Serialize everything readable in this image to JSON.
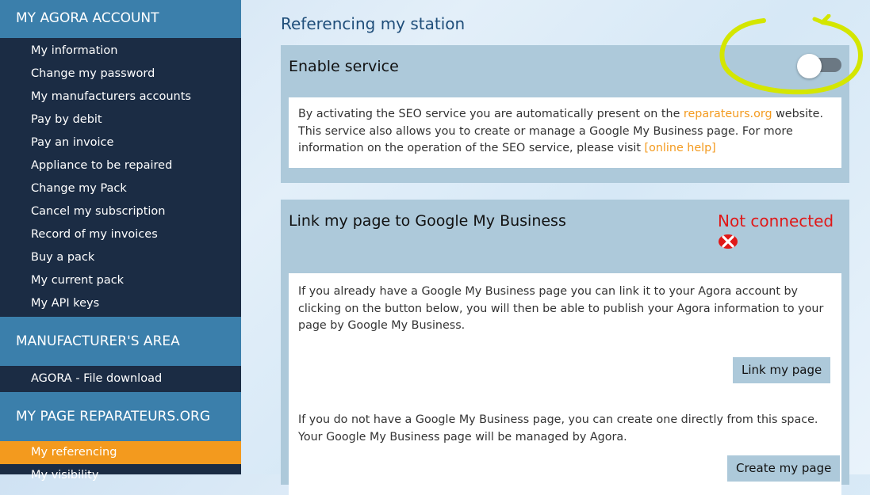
{
  "sidebar": {
    "section1": {
      "title": "MY AGORA ACCOUNT",
      "items": [
        {
          "label": "My information"
        },
        {
          "label": "Change my password"
        },
        {
          "label": "My manufacturers accounts"
        },
        {
          "label": "Pay by debit"
        },
        {
          "label": "Pay an invoice"
        },
        {
          "label": "Appliance to be repaired"
        },
        {
          "label": "Change my Pack"
        },
        {
          "label": "Cancel my subscription"
        },
        {
          "label": "Record of my invoices"
        },
        {
          "label": "Buy a pack"
        },
        {
          "label": "My current pack"
        },
        {
          "label": "My API keys"
        }
      ]
    },
    "section2": {
      "title": "MANUFACTURER'S AREA",
      "items": [
        {
          "label": "AGORA - File download"
        }
      ]
    },
    "section3": {
      "title": "MY PAGE REPARATEURS.ORG",
      "items": [
        {
          "label": "My referencing",
          "active": true
        },
        {
          "label": "My visibility"
        }
      ]
    }
  },
  "main": {
    "title": "Referencing my station",
    "service_panel": {
      "title": "Enable service",
      "toggle_enabled": false,
      "text_before": "By activating the SEO service you are automatically present on the ",
      "site_link": "reparateurs.org",
      "text_after": " website. This service also allows you to create or manage a Google My Business page. For more information on the operation of the SEO service, please visit ",
      "help_link": "[online help]"
    },
    "gmb_panel": {
      "title": "Link my page to Google My Business",
      "status": "Not connected",
      "status_icon": "error-x-icon",
      "link_text": "If you already have a Google My Business page you can link it to your Agora account by clicking on the button below, you will then be able to publish your Agora information to your page by Google My Business.",
      "link_button": "Link my page",
      "create_text": "If you do not have a Google My Business page, you can create one directly from this space. Your Google My Business page will be managed by Agora.",
      "create_button": "Create my page"
    }
  },
  "colors": {
    "sidebar_bg": "#1b2c44",
    "sidebar_header": "#3b7fab",
    "active_item": "#f39a1e",
    "panel_bg": "#adc9da",
    "link_orange": "#f39a1e",
    "error_red": "#e01818",
    "highlight": "#d4e600"
  }
}
